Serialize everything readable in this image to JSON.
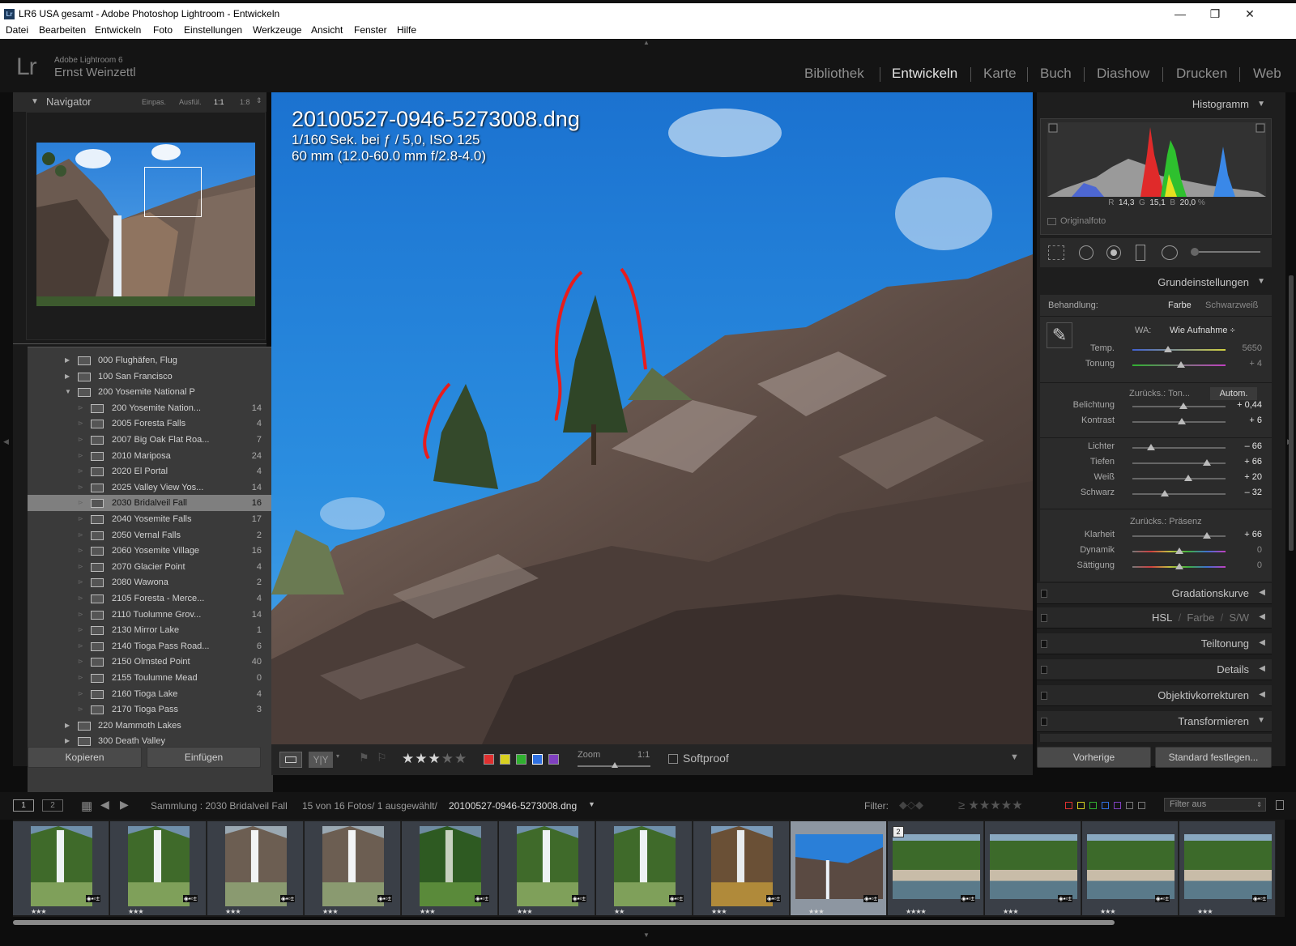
{
  "window": {
    "title": "LR6 USA gesamt - Adobe Photoshop Lightroom - Entwickeln",
    "app_icon": "Lr"
  },
  "menu": [
    "Datei",
    "Bearbeiten",
    "Entwickeln",
    "Foto",
    "Einstellungen",
    "Werkzeuge",
    "Ansicht",
    "Fenster",
    "Hilfe"
  ],
  "identity": {
    "logo": "Lr",
    "product": "Adobe Lightroom 6",
    "user": "Ernst Weinzettl"
  },
  "modules": [
    "Bibliothek",
    "Entwickeln",
    "Karte",
    "Buch",
    "Diashow",
    "Drucken",
    "Web"
  ],
  "active_module": "Entwickeln",
  "navigator": {
    "title": "Navigator",
    "zoom_options": [
      "Einpas.",
      "Ausfül.",
      "1:1",
      "1:8"
    ],
    "active_zoom": "1:1"
  },
  "folders": [
    {
      "label": "000 Flughäfen, Flug",
      "count": "",
      "level": 0,
      "expander": "▶"
    },
    {
      "label": "100 San Francisco",
      "count": "",
      "level": 0,
      "expander": "▶"
    },
    {
      "label": "200 Yosemite National P",
      "count": "",
      "level": 0,
      "expander": "▼"
    },
    {
      "label": "200 Yosemite Nation...",
      "count": "14",
      "level": 1
    },
    {
      "label": "2005 Foresta Falls",
      "count": "4",
      "level": 1
    },
    {
      "label": "2007 Big Oak Flat Roa...",
      "count": "7",
      "level": 1
    },
    {
      "label": "2010 Mariposa",
      "count": "24",
      "level": 1
    },
    {
      "label": "2020 El Portal",
      "count": "4",
      "level": 1
    },
    {
      "label": "2025 Valley View Yos...",
      "count": "14",
      "level": 1
    },
    {
      "label": "2030 Bridalveil  Fall",
      "count": "16",
      "level": 1,
      "selected": true
    },
    {
      "label": "2040 Yosemite Falls",
      "count": "17",
      "level": 1
    },
    {
      "label": "2050 Vernal Falls",
      "count": "2",
      "level": 1
    },
    {
      "label": "2060 Yosemite Village",
      "count": "16",
      "level": 1
    },
    {
      "label": "2070 Glacier Point",
      "count": "4",
      "level": 1
    },
    {
      "label": "2080 Wawona",
      "count": "2",
      "level": 1
    },
    {
      "label": "2105 Foresta - Merce...",
      "count": "4",
      "level": 1
    },
    {
      "label": "2110 Tuolumne Grov...",
      "count": "14",
      "level": 1
    },
    {
      "label": "2130 Mirror Lake",
      "count": "1",
      "level": 1
    },
    {
      "label": "2140 Tioga Pass Road...",
      "count": "6",
      "level": 1
    },
    {
      "label": "2150 Olmsted Point",
      "count": "40",
      "level": 1
    },
    {
      "label": "2155 Toulumne Mead",
      "count": "0",
      "level": 1
    },
    {
      "label": "2160 Tioga Lake",
      "count": "4",
      "level": 1
    },
    {
      "label": "2170 Tioga Pass",
      "count": "3",
      "level": 1
    },
    {
      "label": "220 Mammoth Lakes",
      "count": "",
      "level": 0,
      "expander": "▶"
    },
    {
      "label": "300 Death Valley",
      "count": "",
      "level": 0,
      "expander": "▶"
    }
  ],
  "left_buttons": {
    "copy": "Kopieren",
    "paste": "Einfügen"
  },
  "image_info": {
    "filename": "20100527-0946-5273008.dng",
    "exposure": "1/160 Sek. bei ƒ / 5,0, ISO 125",
    "lens": "60 mm (12.0-60.0 mm f/2.8-4.0)"
  },
  "toolbar": {
    "zoom_label": "Zoom",
    "zoom_value": "1:1",
    "softproof": "Softproof",
    "rating": 3,
    "rating_max": 5,
    "color_labels": [
      "#e03030",
      "#d8d020",
      "#30b030",
      "#3070e0",
      "#8040c0"
    ],
    "stars_glyph": "★★★★★"
  },
  "histogram": {
    "title": "Histogramm",
    "r_label": "R",
    "r": "14,3",
    "g_label": "G",
    "g": "15,1",
    "b_label": "B",
    "b": "20,0",
    "unit": "%",
    "original": "Originalfoto"
  },
  "basic": {
    "title": "Grundeinstellungen",
    "treatment_label": "Behandlung:",
    "color": "Farbe",
    "bw": "Schwarzweiß",
    "wb_label": "WA:",
    "wb_value": "Wie Aufnahme ÷",
    "tone_reset": "Zurücks.: Ton...",
    "auto": "Autom.",
    "presence_reset": "Zurücks.: Präsenz",
    "sliders": [
      {
        "label": "Temp.",
        "value": "5650",
        "pos": 0.38,
        "group": "wb",
        "grad": "temp"
      },
      {
        "label": "Tonung",
        "value": "+ 4",
        "pos": 0.52,
        "group": "wb",
        "grad": "tint"
      },
      {
        "label": "Belichtung",
        "value": "+ 0,44",
        "pos": 0.55,
        "group": "tone"
      },
      {
        "label": "Kontrast",
        "value": "+ 6",
        "pos": 0.53,
        "group": "tone"
      },
      {
        "label": "Lichter",
        "value": "– 66",
        "pos": 0.2,
        "group": "tone2"
      },
      {
        "label": "Tiefen",
        "value": "+ 66",
        "pos": 0.8,
        "group": "tone2"
      },
      {
        "label": "Weiß",
        "value": "+ 20",
        "pos": 0.6,
        "group": "tone2"
      },
      {
        "label": "Schwarz",
        "value": "– 32",
        "pos": 0.35,
        "group": "tone2"
      },
      {
        "label": "Klarheit",
        "value": "+ 66",
        "pos": 0.8,
        "group": "presence"
      },
      {
        "label": "Dynamik",
        "value": "0",
        "pos": 0.5,
        "group": "presence",
        "grad": "vib"
      },
      {
        "label": "Sättigung",
        "value": "0",
        "pos": 0.5,
        "group": "presence",
        "grad": "sat"
      }
    ]
  },
  "panels": {
    "tone_curve": "Gradationskurve",
    "hsl": "HSL",
    "hsl_color": "Farbe",
    "hsl_bw": "S/W",
    "split": "Teiltonung",
    "details": "Details",
    "lens": "Objektivkorrekturen",
    "transform": "Transformieren"
  },
  "right_buttons": {
    "previous": "Vorherige",
    "set_default": "Standard festlegen..."
  },
  "filmbar": {
    "page1": "1",
    "page2": "2",
    "source": "Sammlung : 2030 Bridalveil  Fall",
    "count": "15 von 16 Fotos/ 1 ausgewählt/",
    "file": "20100527-0946-5273008.dng",
    "filter_label": "Filter:",
    "filter_value": "Filter aus"
  },
  "filmstrip": [
    {
      "stars": "★★★",
      "kind": "falls-green"
    },
    {
      "stars": "★★★",
      "kind": "falls-green"
    },
    {
      "stars": "★★★",
      "kind": "falls-mist"
    },
    {
      "stars": "★★★",
      "kind": "falls-mist"
    },
    {
      "stars": "★★★",
      "kind": "forest"
    },
    {
      "stars": "★★★",
      "kind": "falls-green"
    },
    {
      "stars": "★★",
      "kind": "falls-green"
    },
    {
      "stars": "★★★",
      "kind": "falls-autumn"
    },
    {
      "stars": "★★★",
      "kind": "cliff-sky",
      "selected": true
    },
    {
      "stars": "★★★★",
      "kind": "river",
      "badge": "2"
    },
    {
      "stars": "★★★",
      "kind": "river"
    },
    {
      "stars": "★★★",
      "kind": "river"
    },
    {
      "stars": "★★★",
      "kind": "river"
    }
  ]
}
